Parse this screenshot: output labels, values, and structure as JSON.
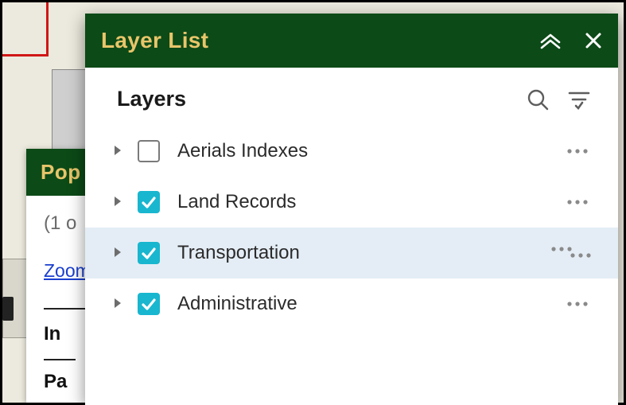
{
  "pop_panel": {
    "header_fragment": "Pop",
    "count_fragment": "(1 o",
    "zoom_to": "Zoom to",
    "in_label_fragment": "In",
    "pa_label_fragment": "Pa"
  },
  "layer_widget": {
    "title": "Layer List",
    "subtitle": "Layers",
    "rows": [
      {
        "label": "Aerials Indexes",
        "checked": false,
        "selected": false
      },
      {
        "label": "Land Records",
        "checked": true,
        "selected": false
      },
      {
        "label": "Transportation",
        "checked": true,
        "selected": true
      },
      {
        "label": "Administrative",
        "checked": true,
        "selected": false
      }
    ]
  },
  "icons": {
    "collapse": "collapse-up-icon",
    "close": "close-icon",
    "search": "search-icon",
    "filter": "filter-list-icon",
    "expand_caret": "caret-right-icon",
    "more": "more-horizontal-icon",
    "check": "checkmark-icon"
  },
  "colors": {
    "header_bg": "#0c4a17",
    "header_text": "#e8c56a",
    "accent_check": "#19b6cf",
    "selected_row": "#e4edf5",
    "link": "#1a3fcf"
  }
}
